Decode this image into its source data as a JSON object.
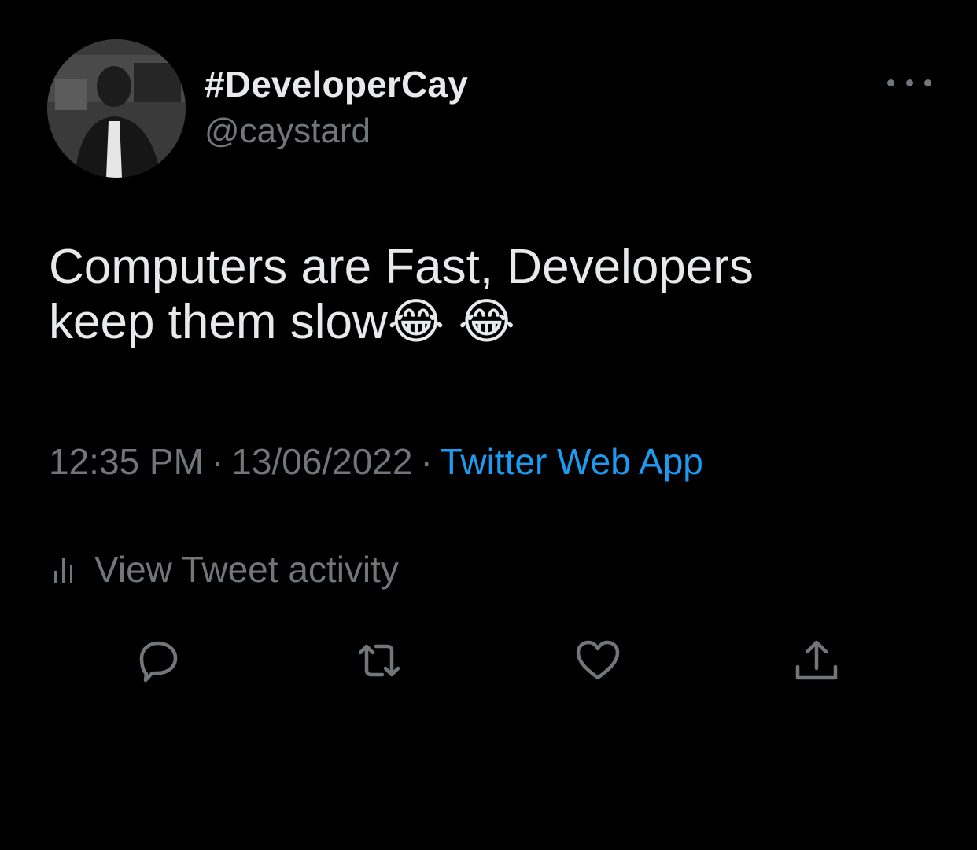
{
  "author": {
    "display_name": "#DeveloperCay",
    "handle": "@caystard",
    "avatar_icon": "profile-photo"
  },
  "tweet": {
    "text": "Computers are Fast, Developers\nkeep them slow😂 😂",
    "time": "12:35 PM",
    "date": "13/06/2022",
    "separator": "·",
    "source": "Twitter Web App"
  },
  "activity": {
    "label": "View Tweet activity",
    "icon": "bar-chart-icon"
  },
  "actions": {
    "reply_icon": "reply-icon",
    "retweet_icon": "retweet-icon",
    "like_icon": "heart-icon",
    "share_icon": "share-icon"
  },
  "colors": {
    "background": "#000000",
    "primary_text": "#e7e9ea",
    "secondary_text": "#71767b",
    "link": "#1d9bf0",
    "divider": "#2f3336"
  }
}
